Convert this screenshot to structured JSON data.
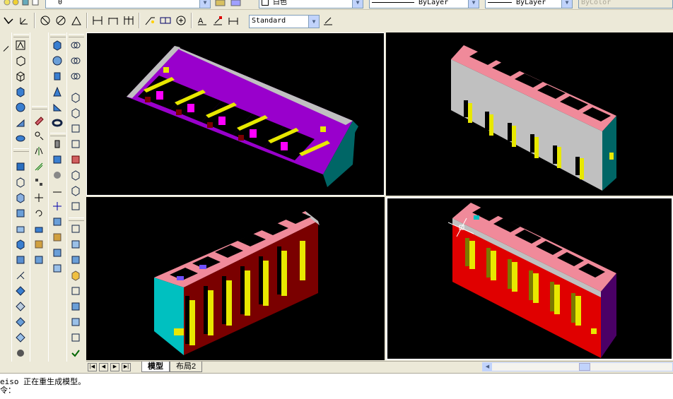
{
  "toolbar": {
    "layer_value": "0",
    "color_value": "白色",
    "linetype_value": "ByLayer",
    "lineweight_value": "ByLayer",
    "plotstyle_value": "ByColor",
    "text_style_value": "Standard"
  },
  "layout_tabs": {
    "model": "模型",
    "layout2": "布局2"
  },
  "command_line": {
    "line1": "eiso 正在重生成模型。",
    "line2": "令："
  },
  "colors": {
    "background": "#000000",
    "purple": "#9900cc",
    "gray": "#c0c0c0",
    "pink": "#f08a9a",
    "teal": "#006666",
    "cyan": "#00c0c0",
    "yellow": "#e8e800",
    "dark_red": "#7a0000",
    "red": "#e00000",
    "magenta": "#ff00ff"
  }
}
